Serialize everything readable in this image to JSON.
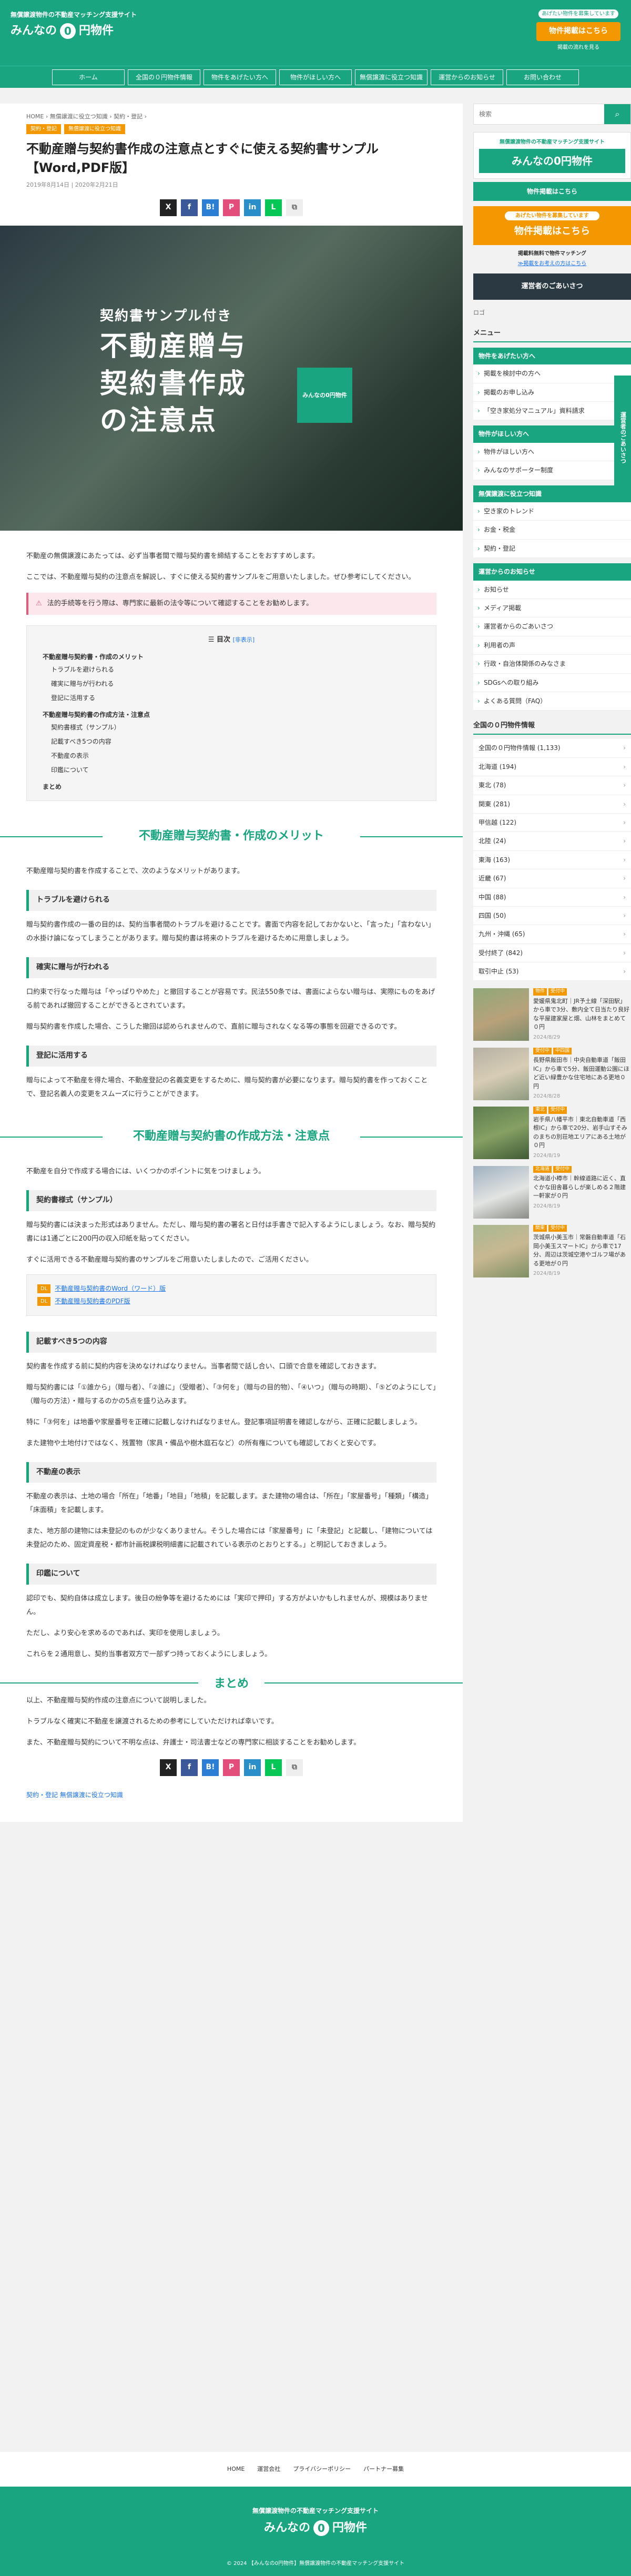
{
  "header": {
    "tagline": "無償譲渡物件の不動産マッチング支援サイト",
    "logo_pre": "みんなの",
    "logo_num": "0",
    "logo_post": "円物件",
    "cta_small": "あげたい物件を募集しています",
    "cta_button": "物件掲載はこちら",
    "cta_link": "掲載の流れを見る"
  },
  "nav": [
    "ホーム",
    "全国の０円物件情報",
    "物件をあげたい方へ",
    "物件がほしい方へ",
    "無償譲渡に役立つ知識",
    "運営からのお知らせ",
    "お問い合わせ"
  ],
  "article": {
    "breadcrumb": "HOME › 無償譲渡に役立つ知識 › 契約・登記 ›",
    "categories": [
      "契約・登記",
      "無償譲渡に役立つ知識"
    ],
    "title": "不動産贈与契約書作成の注意点とすぐに使える契約書サンプル【Word,PDF版】",
    "dates": "2019年8月14日 | 2020年2月21日",
    "share": [
      "X",
      "f",
      "B!",
      "P",
      "in",
      "L",
      "⧉"
    ],
    "hero_sub": "契約書サンプル付き",
    "hero_big1": "不動産贈与",
    "hero_big2": "契約書作成",
    "hero_big3": "の注意点",
    "hero_logo": "みんなの0円物件",
    "intro1": "不動産の無償譲渡にあたっては、必ず当事者間で贈与契約書を締結することをおすすめします。",
    "intro2": "ここでは、不動産贈与契約の注意点を解説し、すぐに使える契約書サンプルをご用意いたしました。ぜひ参考にしてください。",
    "alert": "法的手続等を行う際は、専門家に最新の法令等について確認することをお勧めします。",
    "toc_title": "目次",
    "toc_hide": "[非表示]",
    "toc": [
      {
        "h": "不動産贈与契約書・作成のメリット",
        "items": [
          "トラブルを避けられる",
          "確実に贈与が行われる",
          "登記に活用する"
        ]
      },
      {
        "h": "不動産贈与契約書の作成方法・注意点",
        "items": [
          "契約書様式（サンプル）",
          "記載すべき5つの内容",
          "不動産の表示",
          "印鑑について"
        ]
      },
      {
        "h": "まとめ",
        "items": []
      }
    ],
    "h2_1": "不動産贈与契約書・作成のメリット",
    "p_merit": "不動産贈与契約書を作成することで、次のようなメリットがあります。",
    "h3_1": "トラブルを避けられる",
    "p_h3_1": "贈与契約書作成の一番の目的は、契約当事者間のトラブルを避けることです。書面で内容を記しておかないと、「言った」「言わない」の水掛け論になってしまうことがあります。贈与契約書は将来のトラブルを避けるために用意しましょう。",
    "h3_2": "確実に贈与が行われる",
    "p_h3_2a": "口約束で行なった贈与は「やっぱりやめた」と撤回することが容易です。民法550条では、書面によらない贈与は、実際にものをあげる前であれば撤回することができるとされています。",
    "p_h3_2b": "贈与契約書を作成した場合、こうした撤回は認められませんので、直前に贈与されなくなる等の事態を回避できるのです。",
    "h3_3": "登記に活用する",
    "p_h3_3": "贈与によって不動産を得た場合、不動産登記の名義変更をするために、贈与契約書が必要になります。贈与契約書を作っておくことで、登記名義人の変更をスムーズに行うことができます。",
    "h2_2": "不動産贈与契約書の作成方法・注意点",
    "p_method": "不動産を自分で作成する場合には、いくつかのポイントに気をつけましょう。",
    "h3_4": "契約書様式（サンプル）",
    "p_h3_4a": "贈与契約書には決まった形式はありません。ただし、贈与契約書の署名と日付は手書きで記入するようにしましょう。なお、贈与契約書には1通ごとに200円の収入印紙を貼ってください。",
    "p_h3_4b": "すぐに活用できる不動産贈与契約書のサンプルをご用意いたしましたので、ご活用ください。",
    "downloads": [
      {
        "badge": "DL",
        "label": "不動産贈与契約書のWord（ワード）版"
      },
      {
        "badge": "DL",
        "label": "不動産贈与契約書のPDF版"
      }
    ],
    "h3_5": "記載すべき5つの内容",
    "p_h3_5a": "契約書を作成する前に契約内容を決めなければなりません。当事者間で話し合い、口頭で合意を確認しておきます。",
    "p_h3_5b": "贈与契約書には「①誰から」（贈与者）、「②誰に」（受贈者）、「③何を」（贈与の目的物）、「④いつ」（贈与の時期）、「⑤どのようにして」（贈与の方法）・贈与するのかの5点を盛り込みます。",
    "p_h3_5c": "特に「③何を」は地番や家屋番号を正確に記載しなければなりません。登記事項証明書を確認しながら、正確に記載しましょう。",
    "p_h3_5d": "また建物や土地付けではなく、残置物（家具・備品や樹木庭石など）の所有権についても確認しておくと安心です。",
    "h3_6": "不動産の表示",
    "p_h3_6a": "不動産の表示は、土地の場合「所在」「地番」「地目」「地積」を記載します。また建物の場合は、「所在」「家屋番号」「種類」「構造」「床面積」を記載します。",
    "p_h3_6b": "また、地方部の建物には未登記のものが少なくありません。そうした場合には「家屋番号」に「未登記」と記載し、「建物については未登記のため、固定資産税・都市計画税課税明細書に記載されている表示のとおりとする。」と明記しておきましょう。",
    "h3_7": "印鑑について",
    "p_h3_7a": "認印でも、契約自体は成立します。後日の紛争等を避けるためには「実印で押印」する方がよいかもしれませんが、規模はありません。",
    "p_h3_7b": "ただし、より安心を求めるのであれば、実印を使用しましょう。",
    "p_h3_7c": "これらを２通用意し、契約当事者双方で一部ずつ持っておくようにしましょう。",
    "h2_3": "まとめ",
    "p_sum1": "以上、不動産贈与契約作成の注意点について説明しました。",
    "p_sum2": "トラブルなく確実に不動産を譲渡されるための参考にしていただければ幸いです。",
    "p_sum3": "また、不動産贈与契約について不明な点は、弁護士・司法書士などの専門家に相談することをお勧めします。",
    "bottom_cats": "契約・登記  無償譲渡に役立つ知識"
  },
  "sidebar": {
    "search_placeholder": "検索",
    "logo_top": "無償譲渡物件の不動産マッチング支援サイト",
    "logo_name": "みんなの0円物件",
    "green_btn": "物件掲載はこちら",
    "orange_small": "あげたい物件を募集しています",
    "orange_btn": "物件掲載はこちら",
    "ad_label": "掲載料無料で物件マッチング",
    "ad_link": "≫掲載をお考えの方はこちら",
    "dark_btn": "運営者のごあいさつ",
    "caption": "ロゴ",
    "menu_title": "メニュー",
    "menu": [
      {
        "sec": "物件をあげたい方へ",
        "items": [
          "掲載を検討中の方へ",
          "掲載のお申し込み",
          "「空き家処分マニュアル」資料請求"
        ]
      },
      {
        "sec": "物件がほしい方へ",
        "items": [
          "物件がほしい方へ",
          "みんなのサポーター制度"
        ]
      },
      {
        "sec": "無償譲渡に役立つ知識",
        "items": [
          "空き家のトレンド",
          "お金・税金",
          "契約・登記"
        ]
      },
      {
        "sec": "運営からのお知らせ",
        "items": [
          "お知らせ",
          "メディア掲載",
          "運営者からのごあいさつ",
          "利用者の声",
          "行政・自治体関係のみなさま",
          "SDGsへの取り組み",
          "よくある質問（FAQ）"
        ]
      }
    ],
    "list_title": "全国の０円物件情報",
    "list": [
      "全国の０円物件情報 (1,133)",
      "北海道 (194)",
      "東北 (78)",
      "関東 (281)",
      "甲信越 (122)",
      "北陸 (24)",
      "東海 (163)",
      "近畿 (67)",
      "中国 (88)",
      "四国 (50)",
      "九州・沖縄 (65)",
      "受付終了 (842)",
      "取引中止 (53)"
    ],
    "posts": [
      {
        "badges": [
          "物件",
          "受付中"
        ],
        "text": "愛媛県鬼北町｜JR予土線「深田駅」から車で3分、敷内全て日当たり良好な平屋建家屋と畑、山林をまとめて０円",
        "date": "2024/8/29"
      },
      {
        "badges": [
          "受付中",
          "中四国"
        ],
        "text": "長野県飯田市｜中央自動車道「飯田IC」から車で5分、飯田運動公園にほど近い緑豊かな住宅地にある更地０円",
        "date": "2024/8/28"
      },
      {
        "badges": [
          "東北",
          "受付中"
        ],
        "text": "岩手県八幡平市｜東北自動車道「西根IC」から車で20分、岩手山すそみのまちの別荘地エリアにある土地が０円",
        "date": "2024/8/19"
      },
      {
        "badges": [
          "北海道",
          "受付中"
        ],
        "text": "北海道小樽市｜幹線道路に近く、直ぐかな田舎暮らしが楽しめる２階建一軒家が０円",
        "date": "2024/8/19"
      },
      {
        "badges": [
          "関東",
          "受付中"
        ],
        "text": "茨城県小美玉市｜常磐自動車道「石岡小美玉スマートIC」から車で17分、周辺は茨城空港やゴルフ場がある更地が０円",
        "date": "2024/8/19"
      }
    ],
    "float_bar": "運営者のごあいさつ"
  },
  "footer": {
    "links": [
      "HOME",
      "運営会社",
      "プライバシーポリシー",
      "パートナー募集"
    ],
    "tagline": "無償譲渡物件の不動産マッチング支援サイト",
    "logo_pre": "みんなの",
    "logo_num": "0",
    "logo_post": "円物件",
    "copyright": "© 2024 【みんなの0円物件】無償譲渡物件の不動産マッチング支援サイト"
  }
}
